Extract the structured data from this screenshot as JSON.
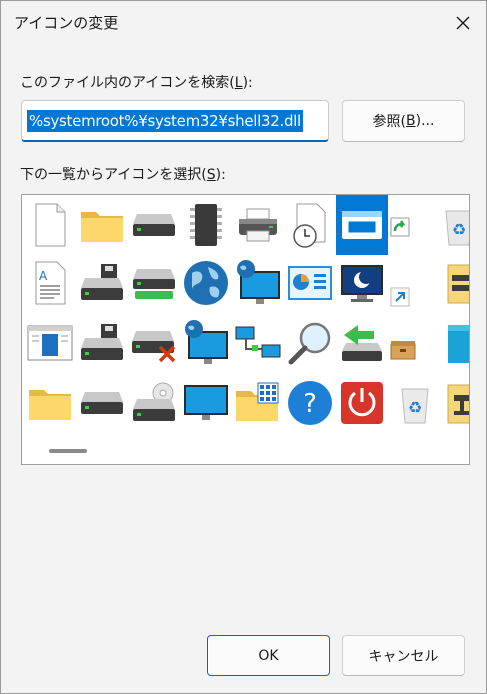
{
  "window": {
    "title": "アイコンの変更"
  },
  "search_label": {
    "prefix": "このファイル内のアイコンを検索(",
    "mnemonic": "L",
    "suffix": "):"
  },
  "path_field": {
    "value": "%systemroot%¥system32¥shell32.dll"
  },
  "browse_button": {
    "prefix": "参照(",
    "mnemonic": "B",
    "suffix": ")..."
  },
  "list_label": {
    "prefix": "下の一覧からアイコンを選択(",
    "mnemonic": "S",
    "suffix": "):"
  },
  "ok_button": {
    "label": "OK"
  },
  "cancel_button": {
    "label": "キャンセル"
  },
  "icons": [
    [
      "blank-document",
      "folder",
      "drive",
      "memory-chip",
      "printer",
      "clock-document",
      "window-app",
      "shortcut-arrow",
      "recycle-bin-full"
    ],
    [
      "text-document",
      "floppy-drive",
      "removable-drive",
      "globe",
      "network-monitor",
      "control-panel",
      "screensaver-monitor",
      "shortcut-arrow-small",
      "network-drive-folder"
    ],
    [
      "app-window",
      "floppy-drive-2",
      "drive-error",
      "network-computer",
      "network-connections",
      "search-magnifier",
      "usb-eject",
      "package-box",
      "cyan-box"
    ],
    [
      "folder-yellow",
      "drive-2",
      "cd-drive",
      "monitor",
      "folder-grid",
      "help-question",
      "power-button",
      "recycle-bin-empty",
      "network-drive-2"
    ]
  ],
  "selected_icon": "window-app"
}
